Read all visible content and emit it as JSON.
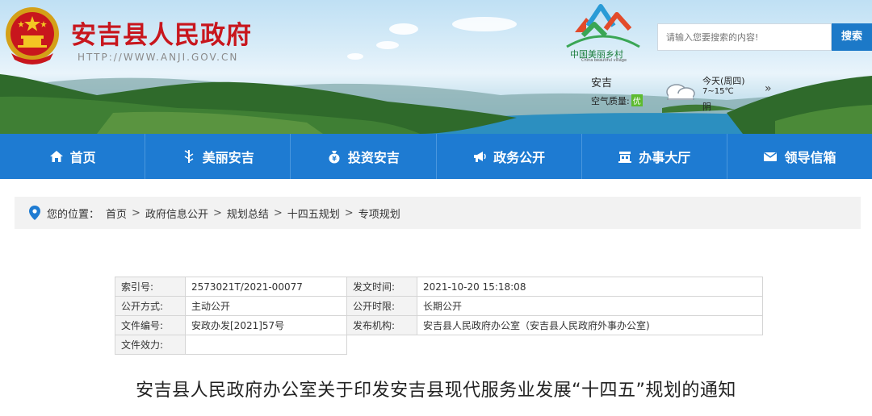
{
  "header": {
    "site_title": "安吉县人民政府",
    "site_url": "HTTP://WWW.ANJI.GOV.CN",
    "village_logo_text": "中国美丽乡村",
    "village_logo_sub": "China beautiful village",
    "search": {
      "placeholder": "请输入您要搜索的内容!",
      "button_label": "搜索"
    },
    "weather": {
      "city": "安吉",
      "air_label": "空气质量:",
      "air_value": "优",
      "today": "今天(周四)",
      "temp": "7~15℃",
      "condition": "阴",
      "more": "»"
    }
  },
  "nav": {
    "items": [
      {
        "label": "首页",
        "icon": "home-icon"
      },
      {
        "label": "美丽安吉",
        "icon": "bamboo-icon"
      },
      {
        "label": "投资安吉",
        "icon": "money-bag-icon"
      },
      {
        "label": "政务公开",
        "icon": "megaphone-icon"
      },
      {
        "label": "办事大厅",
        "icon": "service-hall-icon"
      },
      {
        "label": "领导信箱",
        "icon": "envelope-icon"
      }
    ]
  },
  "breadcrumb": {
    "prefix": "您的位置：",
    "items": [
      "首页",
      "政府信息公开",
      "规划总结",
      "十四五规划",
      "专项规划"
    ],
    "separator": ">"
  },
  "info": {
    "index_label": "索引号:",
    "index_value": "2573021T/2021-00077",
    "date_label": "发文时间:",
    "date_value": "2021-10-20 15:18:08",
    "mode_label": "公开方式:",
    "mode_value": "主动公开",
    "term_label": "公开时限:",
    "term_value": "长期公开",
    "docno_label": "文件编号:",
    "docno_value": "安政办发[2021]57号",
    "issuer_label": "发布机构:",
    "issuer_value": "安吉县人民政府办公室（安吉县人民政府外事办公室)",
    "validity_label": "文件效力:",
    "validity_value": ""
  },
  "document": {
    "title": "安吉县人民政府办公室关于印发安吉县现代服务业发展“十四五”规划的通知"
  },
  "colors": {
    "brand_red": "#c8161d",
    "nav_blue": "#1e7bd2",
    "search_blue": "#1c79c8"
  }
}
